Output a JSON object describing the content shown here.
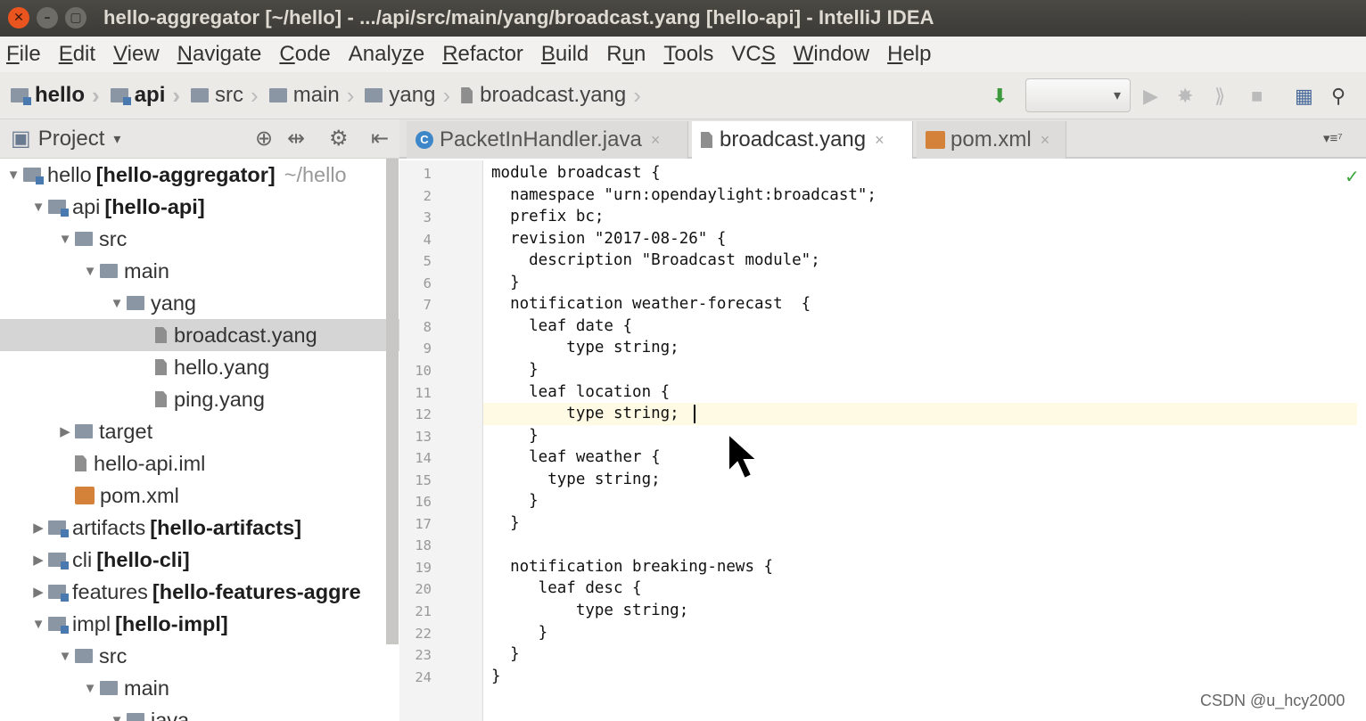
{
  "window": {
    "title": "hello-aggregator [~/hello] - .../api/src/main/yang/broadcast.yang [hello-api] - IntelliJ IDEA",
    "close_glyph": "✕",
    "min_glyph": "–",
    "max_glyph": "▢"
  },
  "menu": [
    {
      "u": "F",
      "rest": "ile"
    },
    {
      "u": "E",
      "rest": "dit"
    },
    {
      "u": "V",
      "rest": "iew"
    },
    {
      "u": "N",
      "rest": "avigate"
    },
    {
      "u": "C",
      "rest": "ode"
    },
    {
      "pre": "Analy",
      "u": "z",
      "rest": "e"
    },
    {
      "u": "R",
      "rest": "efactor"
    },
    {
      "u": "B",
      "rest": "uild"
    },
    {
      "pre": "R",
      "u": "u",
      "rest": "n"
    },
    {
      "u": "T",
      "rest": "ools"
    },
    {
      "pre": "VC",
      "u": "S",
      "rest": ""
    },
    {
      "u": "W",
      "rest": "indow"
    },
    {
      "u": "H",
      "rest": "elp"
    }
  ],
  "breadcrumb": [
    "hello",
    "api",
    "src",
    "main",
    "yang",
    "broadcast.yang"
  ],
  "project_panel": {
    "title": "Project"
  },
  "tree": [
    {
      "label": "hello",
      "bold": "[hello-aggregator]",
      "hint": "~/hello",
      "arrow": "▼"
    },
    {
      "label": "api",
      "bold": "[hello-api]",
      "arrow": "▼"
    },
    {
      "label": "src",
      "arrow": "▼"
    },
    {
      "label": "main",
      "arrow": "▼"
    },
    {
      "label": "yang",
      "arrow": "▼"
    },
    {
      "label": "broadcast.yang"
    },
    {
      "label": "hello.yang"
    },
    {
      "label": "ping.yang"
    },
    {
      "label": "target",
      "arrow": "▶"
    },
    {
      "label": "hello-api.iml"
    },
    {
      "label": "pom.xml"
    },
    {
      "label": "artifacts",
      "bold": "[hello-artifacts]",
      "arrow": "▶"
    },
    {
      "label": "cli",
      "bold": "[hello-cli]",
      "arrow": "▶"
    },
    {
      "label": "features",
      "bold": "[hello-features-aggre",
      "arrow": "▶"
    },
    {
      "label": "impl",
      "bold": "[hello-impl]",
      "arrow": "▼"
    },
    {
      "label": "src",
      "arrow": "▼"
    },
    {
      "label": "main",
      "arrow": "▼"
    },
    {
      "label": "java",
      "arrow": "▼"
    }
  ],
  "tabs": [
    {
      "label": "PacketInHandler.java",
      "icon": "C"
    },
    {
      "label": "broadcast.yang"
    },
    {
      "label": "pom.xml"
    }
  ],
  "tab_close": "×",
  "tabs_menu": "▾≡⁷",
  "code_lines": [
    "module broadcast {",
    "  namespace \"urn:opendaylight:broadcast\";",
    "  prefix bc;",
    "  revision \"2017-08-26\" {",
    "    description \"Broadcast module\";",
    "  }",
    "  notification weather-forecast  {",
    "    leaf date {",
    "        type string;",
    "    }",
    "    leaf location {",
    "        type string;",
    "    }",
    "    leaf weather {",
    "      type string;",
    "    }",
    "  }",
    "",
    "  notification breaking-news {",
    "     leaf desc {",
    "         type string;",
    "     }",
    "  }",
    "}"
  ],
  "line_numbers": [
    "1",
    "2",
    "3",
    "4",
    "5",
    "6",
    "7",
    "8",
    "9",
    "10",
    "11",
    "12",
    "13",
    "14",
    "15",
    "16",
    "17",
    "18",
    "19",
    "20",
    "21",
    "22",
    "23",
    "24"
  ],
  "watermark": "CSDN @u_hcy2000",
  "check_glyph": "✓",
  "icons": {
    "run": "▶",
    "debug": "✸",
    "coverage": "⟫",
    "stop": "■",
    "structure": "▦",
    "search": "⚲",
    "sort": "⬇",
    "sync": "⊕",
    "collapse": "⇹",
    "gear": "⚙",
    "hide": "⇤",
    "dropdown": "▾"
  }
}
